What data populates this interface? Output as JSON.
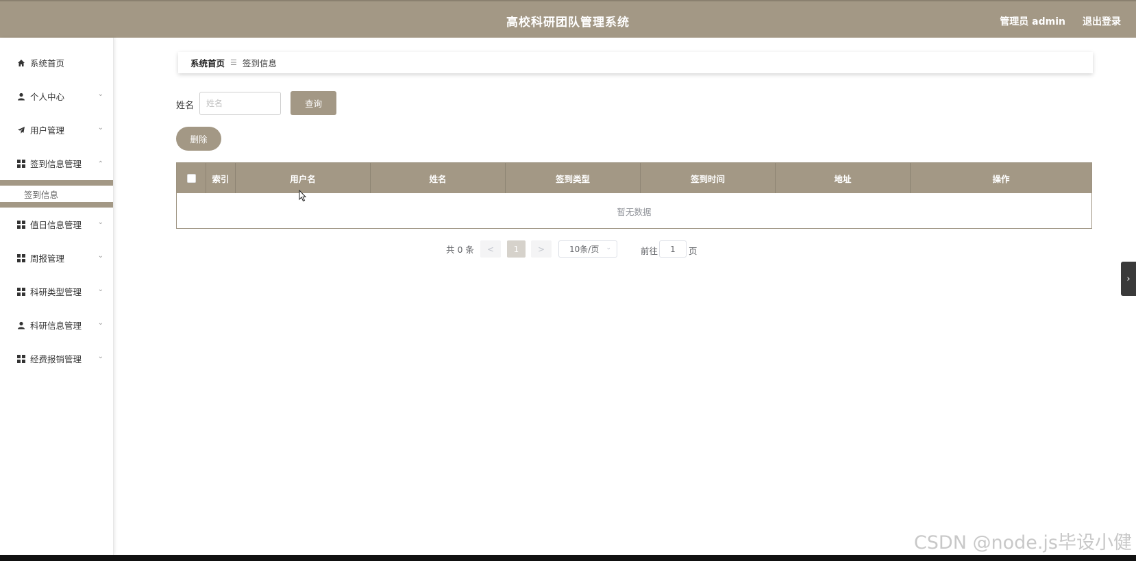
{
  "header": {
    "title": "高校科研团队管理系统",
    "user_label": "管理员 admin",
    "logout_label": "退出登录",
    "bg_color": "#a39885"
  },
  "sidebar": {
    "items": [
      {
        "label": "系统首页",
        "icon": "home-icon"
      },
      {
        "label": "个人中心",
        "icon": "user-icon"
      },
      {
        "label": "用户管理",
        "icon": "send-icon"
      },
      {
        "label": "签到信息管理",
        "icon": "grid-icon",
        "expanded": true,
        "children": [
          {
            "label": "签到信息"
          }
        ]
      },
      {
        "label": "值日信息管理",
        "icon": "grid-icon"
      },
      {
        "label": "周报管理",
        "icon": "grid-icon"
      },
      {
        "label": "科研类型管理",
        "icon": "grid-icon"
      },
      {
        "label": "科研信息管理",
        "icon": "user-icon"
      },
      {
        "label": "经费报销管理",
        "icon": "grid-icon"
      }
    ]
  },
  "breadcrumb": {
    "home": "系统首页",
    "current": "签到信息"
  },
  "search": {
    "label": "姓名",
    "placeholder": "姓名",
    "value": "",
    "query_label": "查询"
  },
  "actions": {
    "delete_label": "删除"
  },
  "table": {
    "columns": [
      "索引",
      "用户名",
      "姓名",
      "签到类型",
      "签到时间",
      "地址",
      "操作"
    ],
    "empty_text": "暂无数据"
  },
  "pagination": {
    "total_text": "共 0 条",
    "prev": "<",
    "current_page": "1",
    "next": ">",
    "page_size": "10条/页",
    "goto_label": "前往",
    "goto_value": "1",
    "goto_unit": "页"
  },
  "watermark": "CSDN @node.js毕设小健"
}
